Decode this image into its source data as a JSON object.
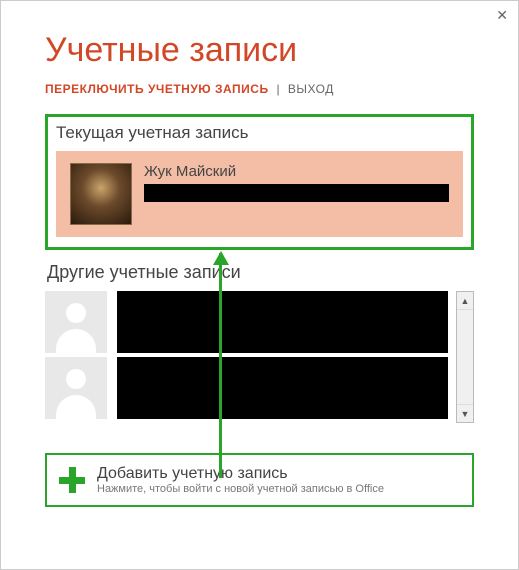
{
  "dialog": {
    "title": "Учетные записи",
    "switch_link": "ПЕРЕКЛЮЧИТЬ УЧЕТНУЮ ЗАПИСЬ",
    "separator": "|",
    "signout_link": "ВЫХОД"
  },
  "current": {
    "section_label": "Текущая учетная запись",
    "name": "Жук Майский"
  },
  "other": {
    "section_label": "Другие учетные записи"
  },
  "add_account": {
    "title": "Добавить учетную запись",
    "subtitle": "Нажмите, чтобы войти с новой учетной записью в Office"
  }
}
